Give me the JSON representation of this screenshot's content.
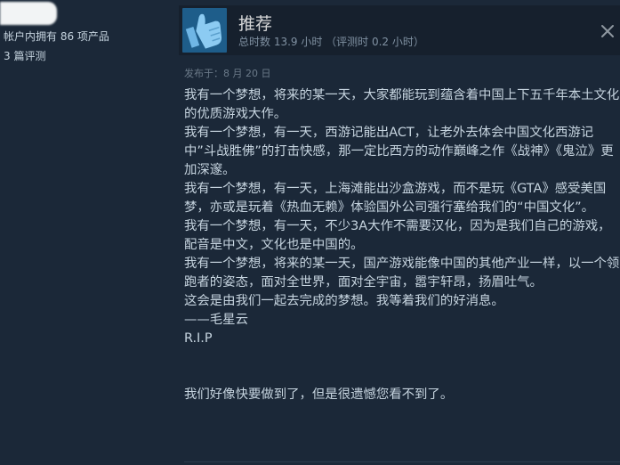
{
  "user": {
    "owned_games": "帐户内拥有 86 项产品",
    "review_count": "3 篇评测"
  },
  "review": {
    "title": "推荐",
    "hours": "总时数 13.9 小时 （评测时 0.2 小时）",
    "posted": "发布于：8 月 20 日",
    "icon": "thumbs-up-icon",
    "paragraphs": [
      "我有一个梦想，将来的某一天，大家都能玩到蕴含着中国上下五千年本土文化的优质游戏大作。",
      "我有一个梦想，有一天，西游记能出ACT，让老外去体会中国文化西游记中”斗战胜佛”的打击快感，那一定比西方的动作巅峰之作《战神》《鬼泣》更加深邃。",
      "我有一个梦想，有一天，上海滩能出沙盒游戏，而不是玩《GTA》感受美国梦，亦或是玩着《热血无赖》体验国外公司强行塞给我们的“中国文化”。",
      "我有一个梦想，有一天，不少3A大作不需要汉化，因为是我们自己的游戏，配音是中文，文化也是中国的。",
      "我有一个梦想，将来的某一天，国产游戏能像中国的其他产业一样，以一个领跑者的姿态，面对全世界，面对全宇宙，嚣宇轩昂，扬眉吐气。",
      "这会是由我们一起去完成的梦想。我等着我们的好消息。",
      "——毛星云",
      "R.I.P"
    ],
    "final_line": "我们好像快要做到了，但是很遗憾您看不到了。"
  },
  "colors": {
    "background": "#1b2838",
    "header_bg": "#16202d",
    "thumb_bg": "#1e5d8a",
    "text": "#c6d4df",
    "muted": "#8091a2"
  }
}
